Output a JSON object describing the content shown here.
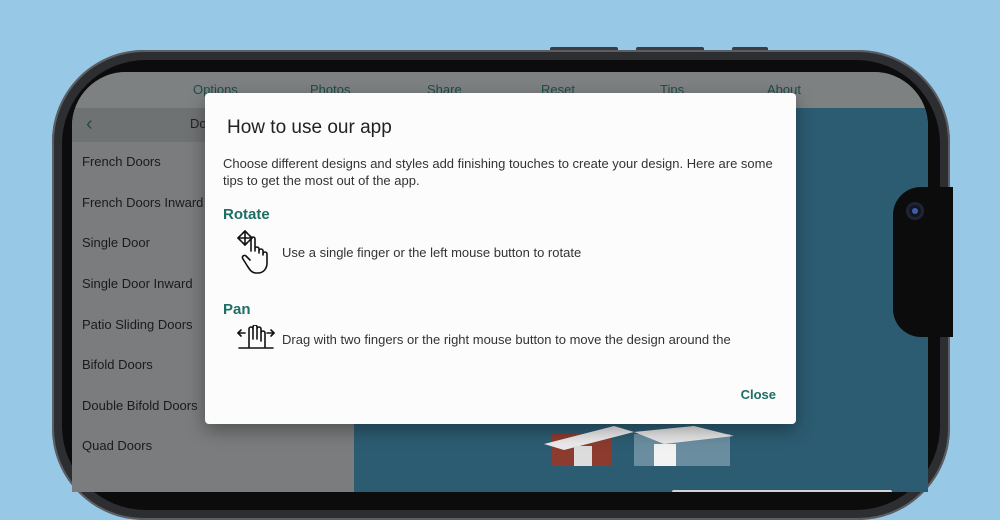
{
  "menu": [
    "Options",
    "Photos",
    "Share",
    "Reset",
    "Tips",
    "About"
  ],
  "sidebar": {
    "header_label": "Do",
    "items": [
      "French Doors",
      "French Doors Inward",
      "Single Door",
      "Single Door Inward",
      "Patio Sliding Doors",
      "Bifold Doors",
      "Double Bifold Doors",
      "Quad Doors"
    ]
  },
  "dialog": {
    "title": "How to use our app",
    "intro": "Choose different designs and styles add finishing touches to create your design. Here are some tips to get the most out of the app.",
    "rotate": {
      "title": "Rotate",
      "text": "Use a single finger or the left mouse button to rotate",
      "icon": "rotate-gesture-icon"
    },
    "pan": {
      "title": "Pan",
      "text": "Drag with two fingers or the right mouse button to move the design around the",
      "icon": "pan-gesture-icon"
    },
    "close_label": "Close"
  },
  "colors": {
    "accent": "#1d6e64",
    "background": "#97c8e6"
  }
}
